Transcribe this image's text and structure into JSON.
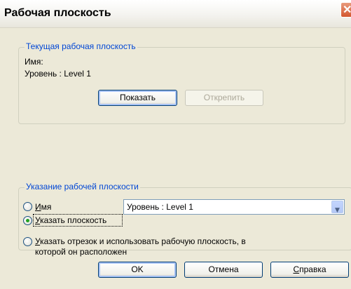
{
  "window": {
    "title": "Рабочая плоскость",
    "close_glyph": "✕"
  },
  "current_plane": {
    "legend": "Текущая рабочая плоскость",
    "name_label": "Имя:",
    "level_label": "Уровень : Level 1",
    "show_button": "Показать",
    "detach_button": "Открепить"
  },
  "specify_plane": {
    "legend": "Указание рабочей плоскости",
    "name_option": {
      "label_mnemonic": "И",
      "label_rest": "мя",
      "selected": false
    },
    "name_combo_value": "Уровень : Level 1",
    "pick_plane_option": {
      "label_mnemonic": "У",
      "label_rest": "казать плоскость",
      "selected": true
    },
    "pick_line_option": {
      "label_mnemonic": "У",
      "label_rest_line1": "казать отрезок и использовать рабочую плоскость, в",
      "label_line2": "которой он расположен",
      "selected": false
    }
  },
  "buttons": {
    "ok": "OK",
    "cancel": "Отмена",
    "help_mnemonic": "С",
    "help_rest": "правка"
  },
  "icons": {
    "combo_arrow": "▼"
  },
  "colors": {
    "legend": "#0046d5",
    "dialog_bg": "#ece9d8",
    "radio_dot": "#21a121"
  }
}
